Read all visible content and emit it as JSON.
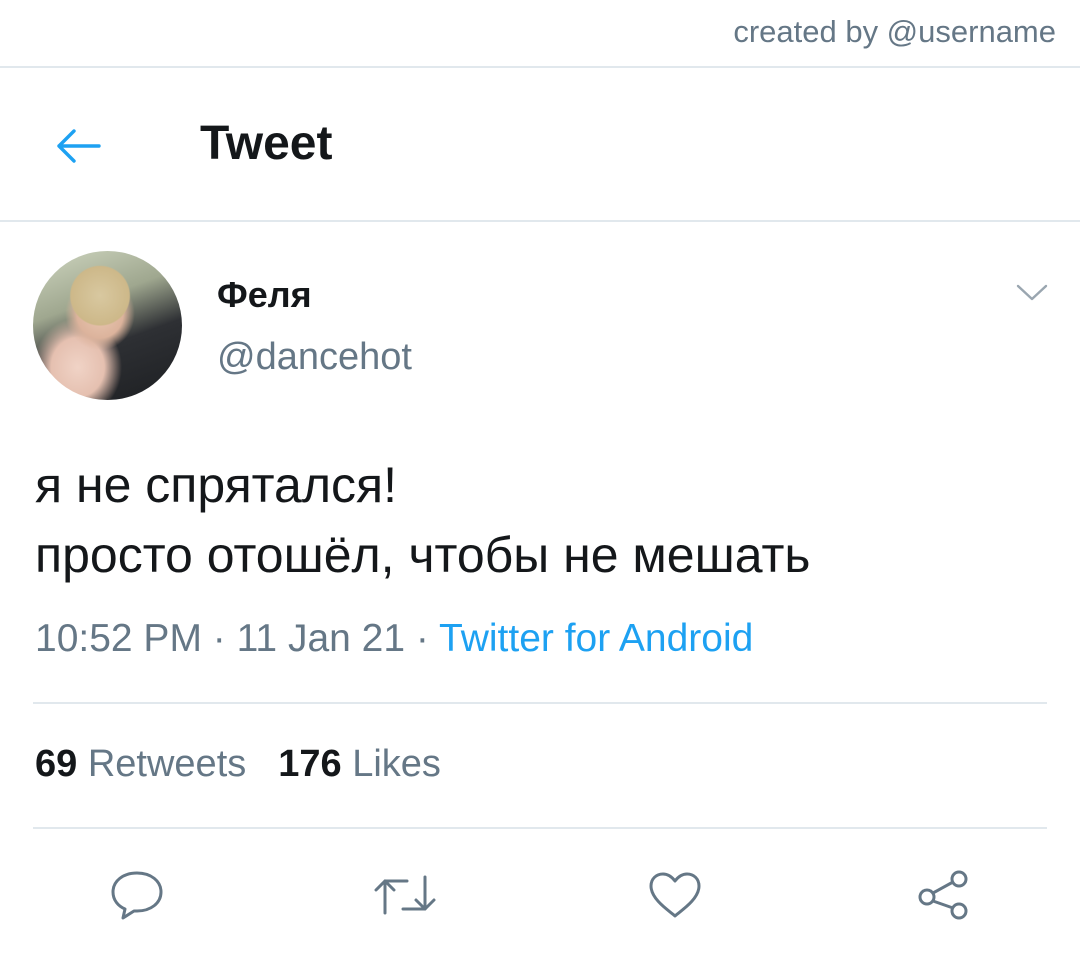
{
  "credit": "created by @username",
  "header": {
    "title": "Tweet",
    "back_icon": "arrow-left-icon"
  },
  "tweet": {
    "author_name": "Феля",
    "author_handle": "@dancehot",
    "text_lines": [
      "я не спрятался!",
      "просто отошёл, чтобы не мешать"
    ],
    "time": "10:52 PM",
    "separator": "·",
    "date": "11 Jan 21",
    "source": "Twitter for Android"
  },
  "stats": {
    "retweets_count": "69",
    "retweets_label": "Retweets",
    "likes_count": "176",
    "likes_label": "Likes"
  },
  "actions": [
    "reply-icon",
    "retweet-icon",
    "like-icon",
    "share-icon"
  ],
  "colors": {
    "accent": "#1da1f2",
    "text": "#14171a",
    "secondary": "#657786",
    "divider": "#e1e8ed"
  }
}
